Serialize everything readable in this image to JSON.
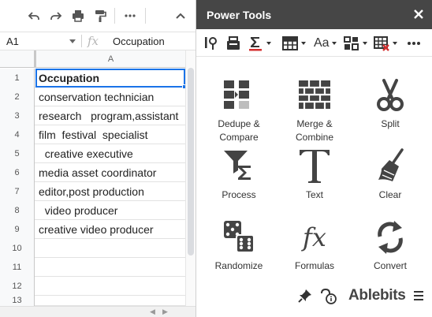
{
  "sheet": {
    "toolbar": {
      "undo_icon": "undo-icon",
      "redo_icon": "redo-icon",
      "print_icon": "print-icon",
      "paint_format_icon": "paint-format-icon",
      "more_icon": "more-horizontal-icon",
      "collapse_icon": "chevron-up-icon"
    },
    "name_box": "A1",
    "formula_value": "Occupation",
    "column_header": "A",
    "rows": [
      {
        "num": "1",
        "value": "Occupation"
      },
      {
        "num": "2",
        "value": "conservation technician"
      },
      {
        "num": "3",
        "value": "research   program,assistant"
      },
      {
        "num": "4",
        "value": "film  festival  specialist"
      },
      {
        "num": "5",
        "value": "  creative executive"
      },
      {
        "num": "6",
        "value": "media asset coordinator"
      },
      {
        "num": "7",
        "value": "editor,post production"
      },
      {
        "num": "8",
        "value": "  video producer"
      },
      {
        "num": "9",
        "value": "creative video producer"
      },
      {
        "num": "10",
        "value": ""
      },
      {
        "num": "11",
        "value": ""
      },
      {
        "num": "12",
        "value": ""
      },
      {
        "num": "13",
        "value": ""
      }
    ]
  },
  "panel": {
    "title": "Power Tools",
    "accent": "#464646",
    "toolbar_text": "Aa",
    "tools": [
      {
        "id": "dedupe",
        "label": "Dedupe & Compare"
      },
      {
        "id": "merge",
        "label": "Merge & Combine"
      },
      {
        "id": "split",
        "label": "Split"
      },
      {
        "id": "process",
        "label": "Process"
      },
      {
        "id": "text",
        "label": "Text"
      },
      {
        "id": "clear",
        "label": "Clear"
      },
      {
        "id": "randomize",
        "label": "Randomize"
      },
      {
        "id": "formulas",
        "label": "Formulas"
      },
      {
        "id": "convert",
        "label": "Convert"
      }
    ],
    "footer": {
      "brand": "Ablebits"
    }
  }
}
